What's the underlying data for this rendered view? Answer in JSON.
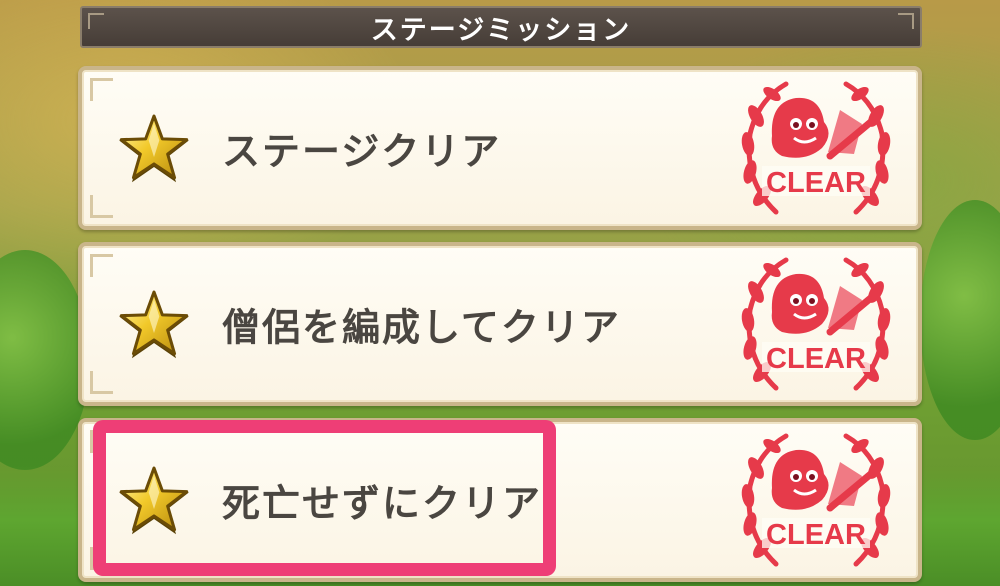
{
  "header": {
    "title": "ステージミッション"
  },
  "missions": [
    {
      "label": "ステージクリア",
      "stamp": "CLEAR",
      "icon": "gold-star-icon"
    },
    {
      "label": "僧侶を編成してクリア",
      "stamp": "CLEAR",
      "icon": "gold-star-icon"
    },
    {
      "label": "死亡せずにクリア",
      "stamp": "CLEAR",
      "icon": "gold-star-icon"
    }
  ],
  "highlight": {
    "target": "mission-3",
    "color": "#ee3e76"
  },
  "colors": {
    "stamp_red": "#e63a4a",
    "text": "#4a4641",
    "card_border": "#c9b58a",
    "header_bg": "#4f4640"
  }
}
